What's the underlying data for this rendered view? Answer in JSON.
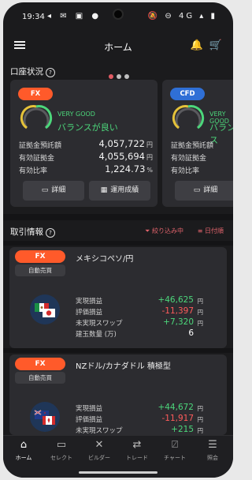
{
  "status": {
    "time": "19:34",
    "network": "4G"
  },
  "header": {
    "title": "ホーム"
  },
  "account": {
    "title": "口座状況",
    "cards": [
      {
        "type": "FX",
        "color": "#ff5a2a",
        "rating": "VERY GOOD",
        "status": "バランスが良い",
        "rows": [
          {
            "label": "証拠金預託額",
            "value": "4,057,722",
            "unit": "円"
          },
          {
            "label": "有効証拠金",
            "value": "4,055,694",
            "unit": "円"
          },
          {
            "label": "有効比率",
            "value": "1,224.73",
            "unit": "%"
          }
        ],
        "buttons": [
          "詳細",
          "運用成績"
        ]
      },
      {
        "type": "CFD",
        "color": "#2f6fd6",
        "rating": "VERY GOOD",
        "status": "バランス",
        "rows": [
          {
            "label": "証拠金預託額"
          },
          {
            "label": "有効証拠金"
          },
          {
            "label": "有効比率"
          }
        ],
        "buttons": [
          "詳細"
        ]
      }
    ]
  },
  "trades": {
    "title": "取引情報",
    "filter": "絞り込み中",
    "sort": "日付順",
    "items": [
      {
        "type": "FX",
        "auto": "自動売買",
        "name": "メキシコペソ/円",
        "rows": [
          {
            "label": "実現損益",
            "value": "+46,625",
            "unit": "円",
            "color": "#4cd77b"
          },
          {
            "label": "評価損益",
            "value": "-11,397",
            "unit": "円",
            "color": "#ff5b5b"
          },
          {
            "label": "未実現スワップ",
            "value": "+7,320",
            "unit": "円",
            "color": "#4cd77b"
          },
          {
            "label": "建玉数量 (万)",
            "value": "6",
            "unit": "",
            "color": "#ffffff"
          }
        ]
      },
      {
        "type": "FX",
        "auto": "自動売買",
        "name": "NZドル/カナダドル 積極型",
        "rows": [
          {
            "label": "実現損益",
            "value": "+44,672",
            "unit": "円",
            "color": "#4cd77b"
          },
          {
            "label": "評価損益",
            "value": "-11,917",
            "unit": "円",
            "color": "#ff5b5b"
          },
          {
            "label": "未実現スワップ",
            "value": "+215",
            "unit": "円",
            "color": "#4cd77b"
          }
        ]
      }
    ]
  },
  "tabs": [
    "ホーム",
    "セレクト",
    "ビルダー",
    "トレード",
    "チャート",
    "照会"
  ]
}
